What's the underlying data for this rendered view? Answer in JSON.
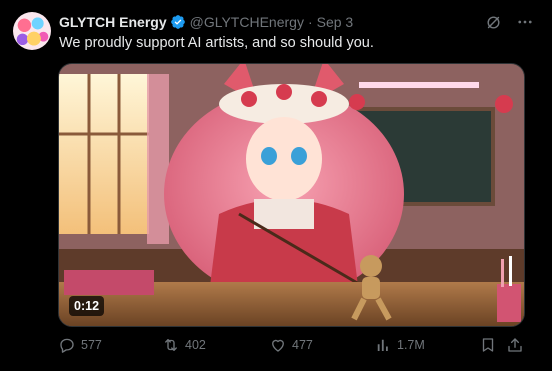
{
  "tweet": {
    "display_name": "GLYTCH Energy",
    "handle": "@GLYTCHEnergy",
    "separator": "·",
    "date": "Sep 3",
    "text": "We proudly support AI artists, and so should you.",
    "verified": true,
    "verified_color": "#1d9bf0"
  },
  "media": {
    "type": "video",
    "duration": "0:12",
    "description_icon": "video-thumbnail"
  },
  "actions": {
    "replies": "577",
    "reposts": "402",
    "likes": "477",
    "views": "1.7M"
  },
  "icons": {
    "header_right": [
      "grok-icon",
      "more-icon"
    ],
    "action_bar": [
      "reply-icon",
      "repost-icon",
      "like-icon",
      "views-icon",
      "bookmark-icon",
      "share-icon"
    ]
  },
  "colors": {
    "background": "#000000",
    "text_primary": "#e7e9ea",
    "text_secondary": "#71767b"
  }
}
